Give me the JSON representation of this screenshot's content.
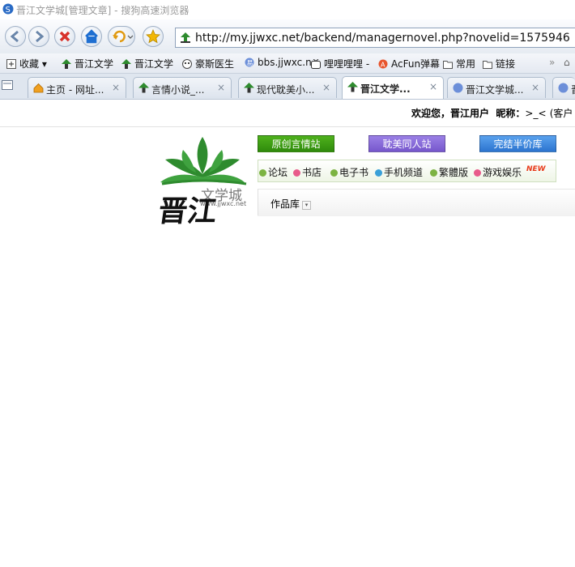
{
  "window": {
    "title": "晋江文学城[管理文章] - 搜狗高速浏览器"
  },
  "address": {
    "url": "http://my.jjwxc.net/backend/managernovel.php?novelid=1575946"
  },
  "bookmarks": [
    {
      "label": "收藏",
      "icon": "plus-box-icon"
    },
    {
      "label": "晋江文学",
      "icon": "jjwxc-tree-icon"
    },
    {
      "label": "晋江文学",
      "icon": "jjwxc-tree-icon"
    },
    {
      "label": "豪斯医生",
      "icon": "face-icon"
    },
    {
      "label": "bbs.jjwxc.n",
      "icon": "sogou-icon"
    },
    {
      "label": "哩哩哩哩 -",
      "icon": "tv-icon"
    },
    {
      "label": "AcFun弹幕",
      "icon": "acfun-icon"
    },
    {
      "label": "常用",
      "icon": "folder-icon"
    },
    {
      "label": "链接",
      "icon": "folder-icon"
    }
  ],
  "tabs": [
    {
      "label": "主页 - 网址...",
      "icon": "home-icon"
    },
    {
      "label": "言情小说_...",
      "icon": "jjwxc-tree-icon"
    },
    {
      "label": "现代耽美小...",
      "icon": "jjwxc-tree-icon"
    },
    {
      "label": "晋江文学...",
      "icon": "jjwxc-tree-icon"
    },
    {
      "label": "晋江文学城...",
      "icon": "sogou-icon"
    },
    {
      "label": "晋",
      "icon": "sogou-icon"
    }
  ],
  "page": {
    "welcome": "欢迎您，晋江用户",
    "nickname_label": "昵称：",
    "nickname_value": ">_<",
    "nickname_suffix": "(客户",
    "logo_text": "文学城",
    "logo_url": "www.jjwxc.net",
    "logo_calligraphy": "晋江",
    "top_buttons": [
      {
        "label": "原创言情站",
        "color": "#3c9a12"
      },
      {
        "label": "耽美同人站",
        "color": "#8a6ad8"
      },
      {
        "label": "完结半价库",
        "color": "#3e8ae0"
      }
    ],
    "subnav": [
      {
        "label": "论坛",
        "color": "#7cb342"
      },
      {
        "label": "书店",
        "color": "#e85a8a"
      },
      {
        "label": "电子书",
        "color": "#7cb342"
      },
      {
        "label": "手机频道",
        "color": "#3aa0d8"
      },
      {
        "label": "繁體版",
        "color": "#7cb342"
      },
      {
        "label": "游戏娱乐",
        "color": "#e85a8a"
      }
    ],
    "new_badge": "NEW",
    "library_label": "作品库"
  },
  "colors": {
    "accent_green": "#2e8b2e",
    "chrome": "#dfe6ef"
  }
}
